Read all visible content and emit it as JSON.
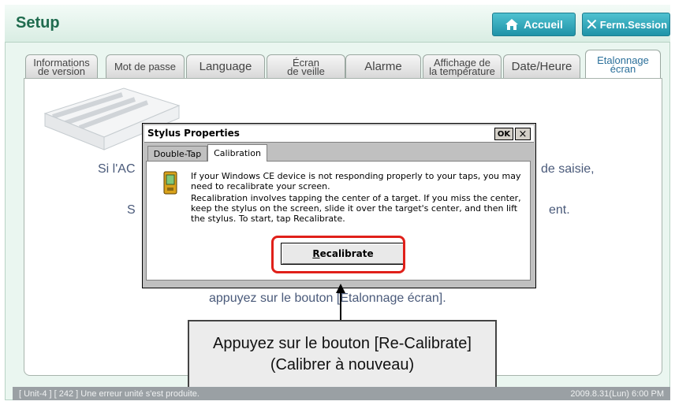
{
  "header": {
    "title": "Setup",
    "home_label": "Accueil",
    "close_label": "Ferm.Session"
  },
  "tabs": [
    {
      "line1": "Informations",
      "line2": "de version"
    },
    {
      "line1": "Mot de passe",
      "line2": ""
    },
    {
      "line1": "Language",
      "line2": ""
    },
    {
      "line1": "Écran",
      "line2": "de veille"
    },
    {
      "line1": "Alarme",
      "line2": ""
    },
    {
      "line1": "Affichage de",
      "line2": "la température"
    },
    {
      "line1": "Date/Heure",
      "line2": ""
    },
    {
      "line1": "Etalonnage",
      "line2": "écran"
    }
  ],
  "panel": {
    "line1_left": "Si l'AC",
    "line1_right": "de saisie,",
    "line2_left": "S",
    "line2_right": "ent.",
    "line3": "appuyez sur le bouton [Etalonnage écran]."
  },
  "dialog": {
    "title": "Stylus Properties",
    "ok": "OK",
    "close": "×",
    "tab1": "Double-Tap",
    "tab2": "Calibration",
    "text1": "If your Windows CE device is not responding properly to your taps, you may need to recalibrate your screen.",
    "text2": "Recalibration involves tapping the center of a target. If you miss the center, keep the stylus on the screen, slide it over the target's center, and then lift the stylus. To start, tap Recalibrate.",
    "button_first": "R",
    "button_rest": "ecalibrate"
  },
  "callout": {
    "line1": "Appuyez sur le bouton [Re-Calibrate]",
    "line2": "(Calibrer à nouveau)"
  },
  "status": {
    "message": "[ Unit-4 ] [ 242 ] Une erreur unité s'est produite.",
    "datetime": "2009.8.31(Lun) 6:00 PM"
  },
  "colors": {
    "highlight": "#e0201a",
    "accent": "#1f93a8",
    "title": "#1f6b4e"
  }
}
